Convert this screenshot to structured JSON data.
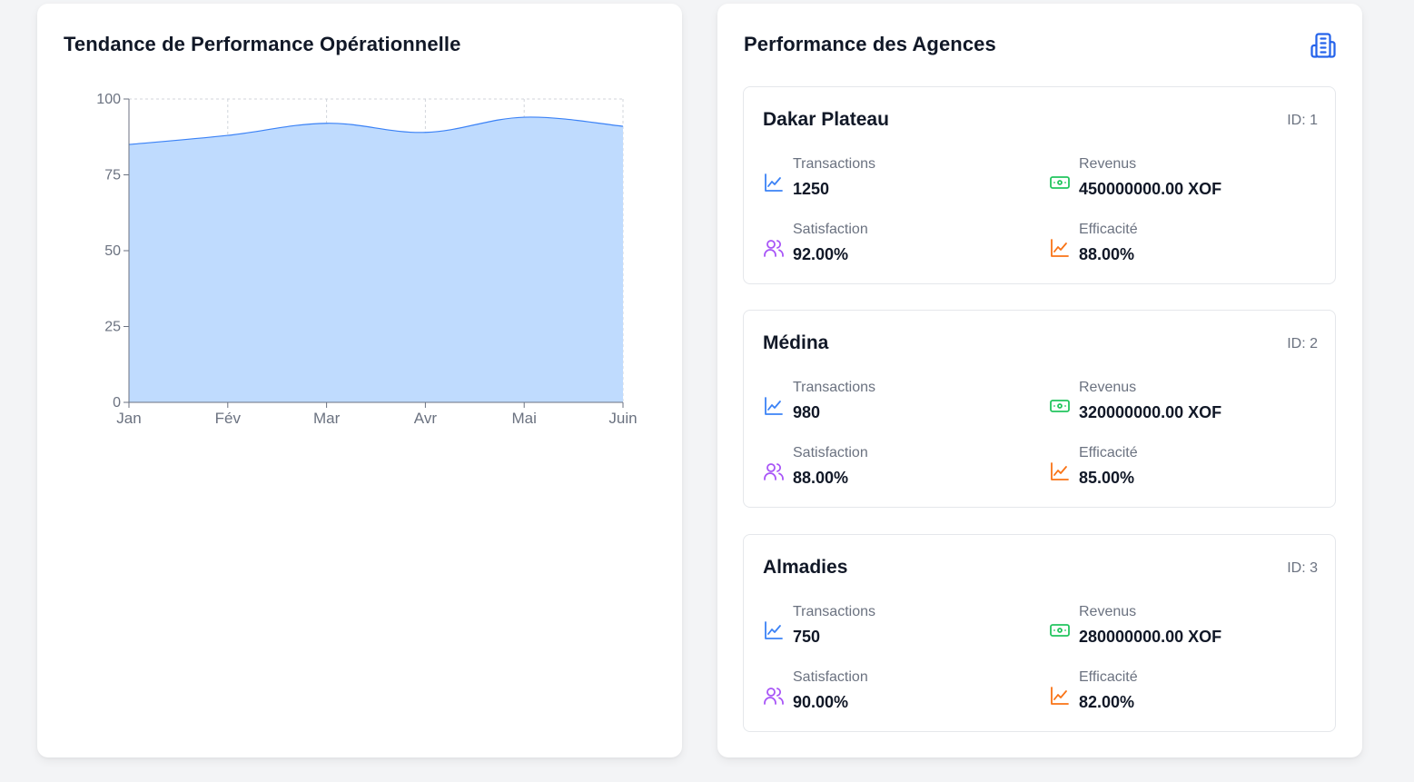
{
  "left_panel": {
    "title": "Tendance de Performance Opérationnelle"
  },
  "right_panel": {
    "title": "Performance des Agences",
    "header_icon": "building-icon"
  },
  "chart_data": {
    "type": "area",
    "categories": [
      "Jan",
      "Fév",
      "Mar",
      "Avr",
      "Mai",
      "Juin"
    ],
    "series": [
      {
        "values": [
          85,
          88,
          92,
          89,
          94,
          91
        ]
      }
    ],
    "ylim": [
      0,
      100
    ],
    "yticks": [
      "0",
      "25",
      "50",
      "75",
      "100"
    ],
    "grid": true,
    "colors": {
      "fill": "#bfdbfe",
      "stroke": "#3b82f6",
      "grid": "#d1d5db",
      "axis": "#6b7280"
    }
  },
  "agencies": [
    {
      "name": "Dakar Plateau",
      "id_label": "ID: 1",
      "transactions_label": "Transactions",
      "transactions": "1250",
      "revenue_label": "Revenus",
      "revenue": "450000000.00 XOF",
      "satisfaction_label": "Satisfaction",
      "satisfaction": "92.00%",
      "efficiency_label": "Efficacité",
      "efficiency": "88.00%"
    },
    {
      "name": "Médina",
      "id_label": "ID: 2",
      "transactions_label": "Transactions",
      "transactions": "980",
      "revenue_label": "Revenus",
      "revenue": "320000000.00 XOF",
      "satisfaction_label": "Satisfaction",
      "satisfaction": "88.00%",
      "efficiency_label": "Efficacité",
      "efficiency": "85.00%"
    },
    {
      "name": "Almadies",
      "id_label": "ID: 3",
      "transactions_label": "Transactions",
      "transactions": "750",
      "revenue_label": "Revenus",
      "revenue": "280000000.00 XOF",
      "satisfaction_label": "Satisfaction",
      "satisfaction": "90.00%",
      "efficiency_label": "Efficacité",
      "efficiency": "82.00%"
    }
  ],
  "icon_colors": {
    "transactions": "#3b82f6",
    "revenue": "#22c55e",
    "satisfaction": "#a855f7",
    "efficiency": "#f97316",
    "header": "#2563eb"
  }
}
